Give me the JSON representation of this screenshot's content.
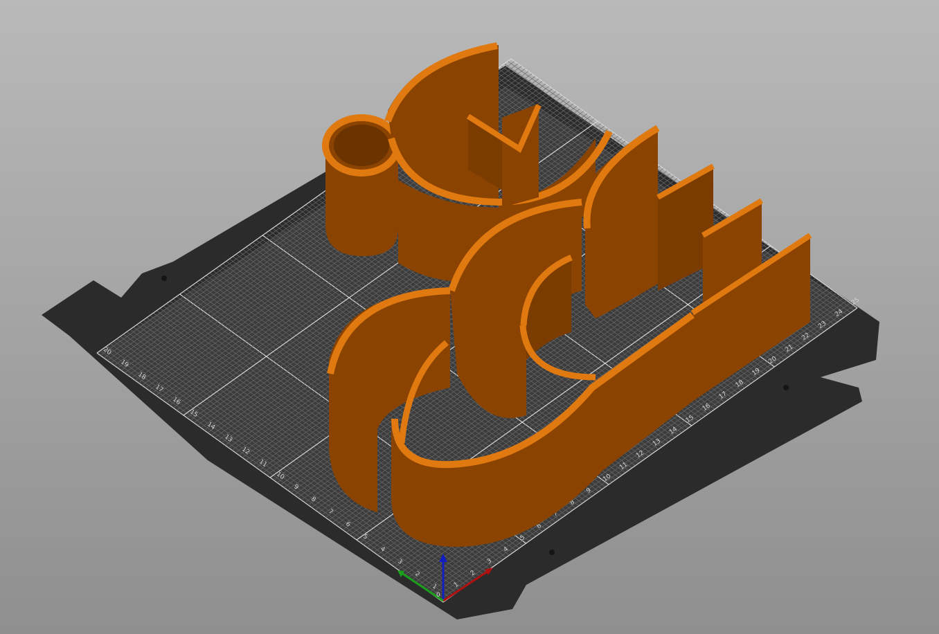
{
  "scene": {
    "background_top": "#b9b9b9",
    "background_bottom": "#8f8f8f",
    "bed_color": "#3a3a3a",
    "bed_frame_color": "#2b2b2b",
    "grid_color": "#6a6a6a",
    "grid_major_color": "#d8d8d8",
    "model_face_color": "#8a4300",
    "model_top_color": "#e07a10",
    "model_edge_color": "#6a3300"
  },
  "bed": {
    "x_ticks": [
      "0",
      "1",
      "2",
      "3",
      "4",
      "5",
      "6",
      "7",
      "8",
      "9",
      "10",
      "11",
      "12",
      "13",
      "14",
      "15",
      "16",
      "17",
      "18",
      "19",
      "20",
      "21",
      "22",
      "23",
      "24",
      "25"
    ],
    "y_ticks": [
      "1",
      "2",
      "3",
      "4",
      "5",
      "6",
      "7",
      "8",
      "9",
      "10",
      "11",
      "12",
      "13",
      "14",
      "15",
      "16",
      "17",
      "18",
      "19",
      "20"
    ]
  },
  "axes": {
    "x_color": "#b01010",
    "y_color": "#1aa01a",
    "z_color": "#1020c0",
    "origin_label": "0"
  }
}
